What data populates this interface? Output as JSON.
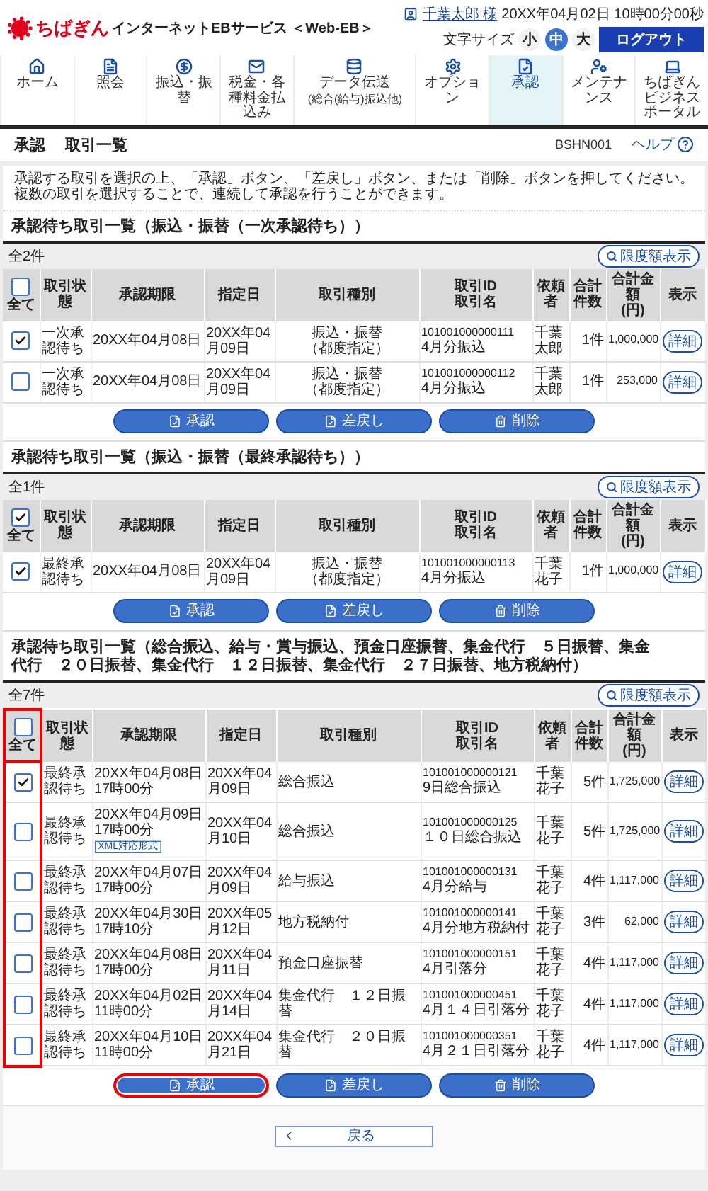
{
  "header": {
    "brand": "ちばぎん",
    "service": "インターネットEBサービス ＜Web-EB＞",
    "user": "千葉太郎 様",
    "datetime": "20XX年04月02日 10時00分00秒",
    "font_size_label": "文字サイズ",
    "font_sizes": [
      {
        "label": "小",
        "selected": false
      },
      {
        "label": "中",
        "selected": true
      },
      {
        "label": "大",
        "selected": false
      }
    ],
    "logout": "ログアウト"
  },
  "nav": [
    {
      "label": "ホーム",
      "selected": false
    },
    {
      "label": "照会",
      "selected": false
    },
    {
      "label": "振込・振替",
      "selected": false
    },
    {
      "label": "税金・各種料金払込み",
      "selected": false
    },
    {
      "label": "データ伝送",
      "sub": "(総合(給与)振込他)",
      "selected": false
    },
    {
      "label": "オプション",
      "selected": false
    },
    {
      "label": "承認",
      "selected": true
    },
    {
      "label": "メンテナンス",
      "selected": false
    },
    {
      "label": "ちばぎんビジネスポータル",
      "selected": false
    }
  ],
  "page_title": {
    "section": "承認",
    "title": "取引一覧",
    "screen_id": "BSHN001",
    "help": "ヘルプ"
  },
  "intro": "承認する取引を選択の上、「承認」ボタン、「差戻し」ボタン、または「削除」ボタンを押してください。複数の取引を選択することで、連続して承認を行うことができます。",
  "sections": [
    {
      "title": "承認待ち取引一覧（振込・振替（一次承認待ち））",
      "count": "全2件",
      "limit_button": "限度額表示",
      "all_label": "全て",
      "all_checked": false,
      "highlight_checkbox_column": false,
      "columns": [
        [
          "取引状態"
        ],
        [
          "承認期限"
        ],
        [
          "指定日"
        ],
        [
          "取引種別"
        ],
        [
          "取引ID",
          "取引名"
        ],
        [
          "依頼者"
        ],
        [
          "合計件数"
        ],
        [
          "合計金額",
          "(円)"
        ],
        [
          "表示"
        ]
      ],
      "rows": [
        {
          "checked": true,
          "status": "一次承認待ち",
          "deadline": "20XX年04月08日",
          "date": "20XX年04月09日",
          "type": "振込・振替",
          "type_note": "（都度指定）",
          "id": "101001000000111",
          "name": "4月分振込",
          "requester": "千葉太郎",
          "count": "1件",
          "amount": "1,000,000",
          "action": "詳細"
        },
        {
          "checked": false,
          "status": "一次承認待ち",
          "deadline": "20XX年04月08日",
          "date": "20XX年04月09日",
          "type": "振込・振替",
          "type_note": "（都度指定）",
          "id": "101001000000112",
          "name": "4月分振込",
          "requester": "千葉太郎",
          "count": "1件",
          "amount": "253,000",
          "action": "詳細"
        }
      ],
      "buttons": [
        {
          "label": "承認",
          "highlighted": false
        },
        {
          "label": "差戻し",
          "highlighted": false
        },
        {
          "label": "削除",
          "highlighted": false
        }
      ]
    },
    {
      "title": "承認待ち取引一覧（振込・振替（最終承認待ち））",
      "count": "全1件",
      "limit_button": "限度額表示",
      "all_label": "全て",
      "all_checked": true,
      "highlight_checkbox_column": false,
      "columns": [
        [
          "取引状態"
        ],
        [
          "承認期限"
        ],
        [
          "指定日"
        ],
        [
          "取引種別"
        ],
        [
          "取引ID",
          "取引名"
        ],
        [
          "依頼者"
        ],
        [
          "合計件数"
        ],
        [
          "合計金額",
          "(円)"
        ],
        [
          "表示"
        ]
      ],
      "rows": [
        {
          "checked": true,
          "status": "最終承認待ち",
          "deadline": "20XX年04月08日",
          "date": "20XX年04月09日",
          "type": "振込・振替",
          "type_note": "（都度指定）",
          "id": "101001000000113",
          "name": "4月分振込",
          "requester": "千葉花子",
          "count": "1件",
          "amount": "1,000,000",
          "action": "詳細"
        }
      ],
      "buttons": [
        {
          "label": "承認",
          "highlighted": false
        },
        {
          "label": "差戻し",
          "highlighted": false
        },
        {
          "label": "削除",
          "highlighted": false
        }
      ]
    },
    {
      "title": "承認待ち取引一覧（総合振込、給与・賞与振込、預金口座振替、集金代行　５日振替、集金代行　２０日振替、集金代行　１２日振替、集金代行　２７日振替、地方税納付）",
      "count": "全7件",
      "limit_button": "限度額表示",
      "all_label": "全て",
      "all_checked": false,
      "highlight_checkbox_column": true,
      "columns": [
        [
          "取引状態"
        ],
        [
          "承認期限"
        ],
        [
          "指定日"
        ],
        [
          "取引種別"
        ],
        [
          "取引ID",
          "取引名"
        ],
        [
          "依頼者"
        ],
        [
          "合計件数"
        ],
        [
          "合計金額",
          "(円)"
        ],
        [
          "表示"
        ]
      ],
      "rows": [
        {
          "checked": true,
          "status": "最終承認待ち",
          "deadline": "20XX年04月08日",
          "deadline_time": "17時00分",
          "date": "20XX年04月09日",
          "type": "総合振込",
          "id": "101001000000121",
          "name": "9日総合振込",
          "requester": "千葉花子",
          "count": "5件",
          "amount": "1,725,000",
          "action": "詳細"
        },
        {
          "checked": false,
          "status": "最終承認待ち",
          "deadline": "20XX年04月09日",
          "deadline_time": "17時00分",
          "tag": "XML対応形式",
          "date": "20XX年04月10日",
          "type": "総合振込",
          "id": "101001000000125",
          "name": "１０日総合振込",
          "requester": "千葉花子",
          "count": "5件",
          "amount": "1,725,000",
          "action": "詳細"
        },
        {
          "checked": false,
          "status": "最終承認待ち",
          "deadline": "20XX年04月07日",
          "deadline_time": "17時00分",
          "date": "20XX年04月09日",
          "type": "給与振込",
          "id": "101001000000131",
          "name": "4月分給与",
          "requester": "千葉花子",
          "count": "4件",
          "amount": "1,117,000",
          "action": "詳細"
        },
        {
          "checked": false,
          "status": "最終承認待ち",
          "deadline": "20XX年04月30日",
          "deadline_time": "17時10分",
          "date": "20XX年05月12日",
          "type": "地方税納付",
          "id": "101001000000141",
          "name": "4月分地方税納付",
          "requester": "千葉花子",
          "count": "3件",
          "amount": "62,000",
          "action": "詳細"
        },
        {
          "checked": false,
          "status": "最終承認待ち",
          "deadline": "20XX年04月08日",
          "deadline_time": "17時00分",
          "date": "20XX年04月11日",
          "type": "預金口座振替",
          "id": "101001000000151",
          "name": "4月引落分",
          "requester": "千葉花子",
          "count": "4件",
          "amount": "1,117,000",
          "action": "詳細"
        },
        {
          "checked": false,
          "status": "最終承認待ち",
          "deadline": "20XX年04月02日",
          "deadline_time": "11時00分",
          "date": "20XX年04月14日",
          "type": "集金代行　１２日振替",
          "id": "101001000000451",
          "name": "4月１４日引落分",
          "requester": "千葉花子",
          "count": "4件",
          "amount": "1,117,000",
          "action": "詳細"
        },
        {
          "checked": false,
          "status": "最終承認待ち",
          "deadline": "20XX年04月10日",
          "deadline_time": "11時00分",
          "date": "20XX年04月21日",
          "type": "集金代行　２０日振替",
          "id": "101001000000351",
          "name": "4月２１日引落分",
          "requester": "千葉花子",
          "count": "4件",
          "amount": "1,117,000",
          "action": "詳細"
        }
      ],
      "buttons": [
        {
          "label": "承認",
          "highlighted": true
        },
        {
          "label": "差戻し",
          "highlighted": false
        },
        {
          "label": "削除",
          "highlighted": false
        }
      ]
    }
  ],
  "back_button": "戻る"
}
